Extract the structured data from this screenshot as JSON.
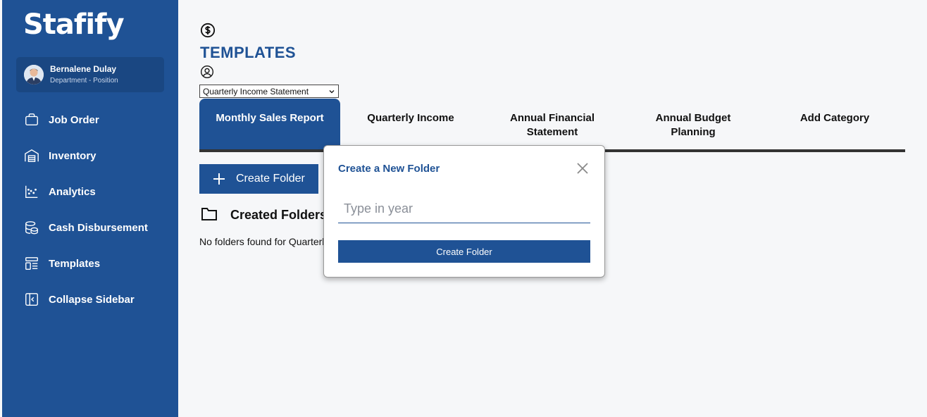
{
  "colors": {
    "primary": "#1f5295",
    "sidebar_card": "#1a4782",
    "background": "#f6f7f9"
  },
  "sidebar": {
    "brand": "Stafify",
    "user": {
      "name": "Bernalene Dulay",
      "department": "Department - Position"
    },
    "items": [
      {
        "label": "Job Order",
        "icon": "briefcase-icon"
      },
      {
        "label": "Inventory",
        "icon": "warehouse-icon"
      },
      {
        "label": "Analytics",
        "icon": "scatter-chart-icon"
      },
      {
        "label": "Cash Disbursement",
        "icon": "coins-icon"
      },
      {
        "label": "Templates",
        "icon": "layout-icon"
      },
      {
        "label": "Collapse Sidebar",
        "icon": "collapse-icon"
      }
    ]
  },
  "main": {
    "title": "TEMPLATES",
    "select": {
      "selected": "Quarterly Income Statement"
    },
    "tabs": [
      {
        "label": "Monthly Sales Report",
        "active": true
      },
      {
        "label": "Quarterly Income",
        "active": false
      },
      {
        "label": "Annual Financial Statement",
        "active": false
      },
      {
        "label": "Annual Budget Planning",
        "active": false
      },
      {
        "label": "Add Category",
        "active": false
      }
    ],
    "create_button": "Create Folder",
    "section_title": "Created Folders",
    "empty_message": "No folders found for Quarterly Income Statement"
  },
  "modal": {
    "title": "Create a New Folder",
    "input_placeholder": "Type in year",
    "input_value": "",
    "submit_label": "Create Folder"
  }
}
